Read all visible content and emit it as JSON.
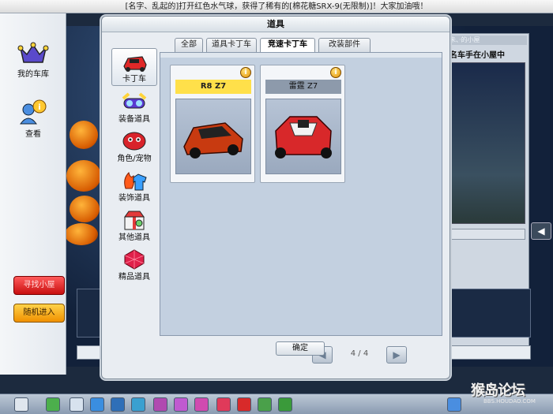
{
  "marquee": "[名字、乱起的]打开红色水气球，获得了稀有的[棉花糖SRX-9(无限制)]！大家加油哦！",
  "left_nav": {
    "items": [
      {
        "label": "我的车库",
        "icon": "crown-icon"
      },
      {
        "label": "查看",
        "icon": "user-info-icon"
      }
    ],
    "find_room": "寻找小屋",
    "random_enter": "随机进入"
  },
  "scene": {
    "right_title": "朱、·的小屋",
    "right_subtitle": "名车手在小屋中"
  },
  "dialog": {
    "title": "道具",
    "categories": [
      {
        "label": "卡丁车",
        "icon": "kart-icon",
        "selected": true
      },
      {
        "label": "装备道具",
        "icon": "goggles-icon",
        "selected": false
      },
      {
        "label": "角色/宠物",
        "icon": "character-icon",
        "selected": false
      },
      {
        "label": "装饰道具",
        "icon": "flame-shirt-icon",
        "selected": false
      },
      {
        "label": "其他道具",
        "icon": "gift-box-icon",
        "selected": false
      },
      {
        "label": "精品道具",
        "icon": "ruby-icon",
        "selected": false
      }
    ],
    "tabs": [
      "全部",
      "道具卡丁车",
      "竞速卡丁车",
      "改装部件"
    ],
    "active_tab": "竞速卡丁车",
    "cards": [
      {
        "name": "R8 Z7",
        "name_bg": "#ffe04a",
        "car_color": "#c83a10"
      },
      {
        "name": "雷霆 Z7",
        "name_bg": "#8d9aab",
        "car_color": "#d8282a"
      }
    ],
    "pager": {
      "text": "4 / 4"
    },
    "ok": "确定"
  },
  "watermark": {
    "main": "猴岛论坛",
    "sub": "BBS.HOUDAO.COM"
  },
  "colors": {
    "accent_yellow": "#ffe04a",
    "dialog_bg": "#e9edf2",
    "panel_bg": "#c3d0e0"
  }
}
